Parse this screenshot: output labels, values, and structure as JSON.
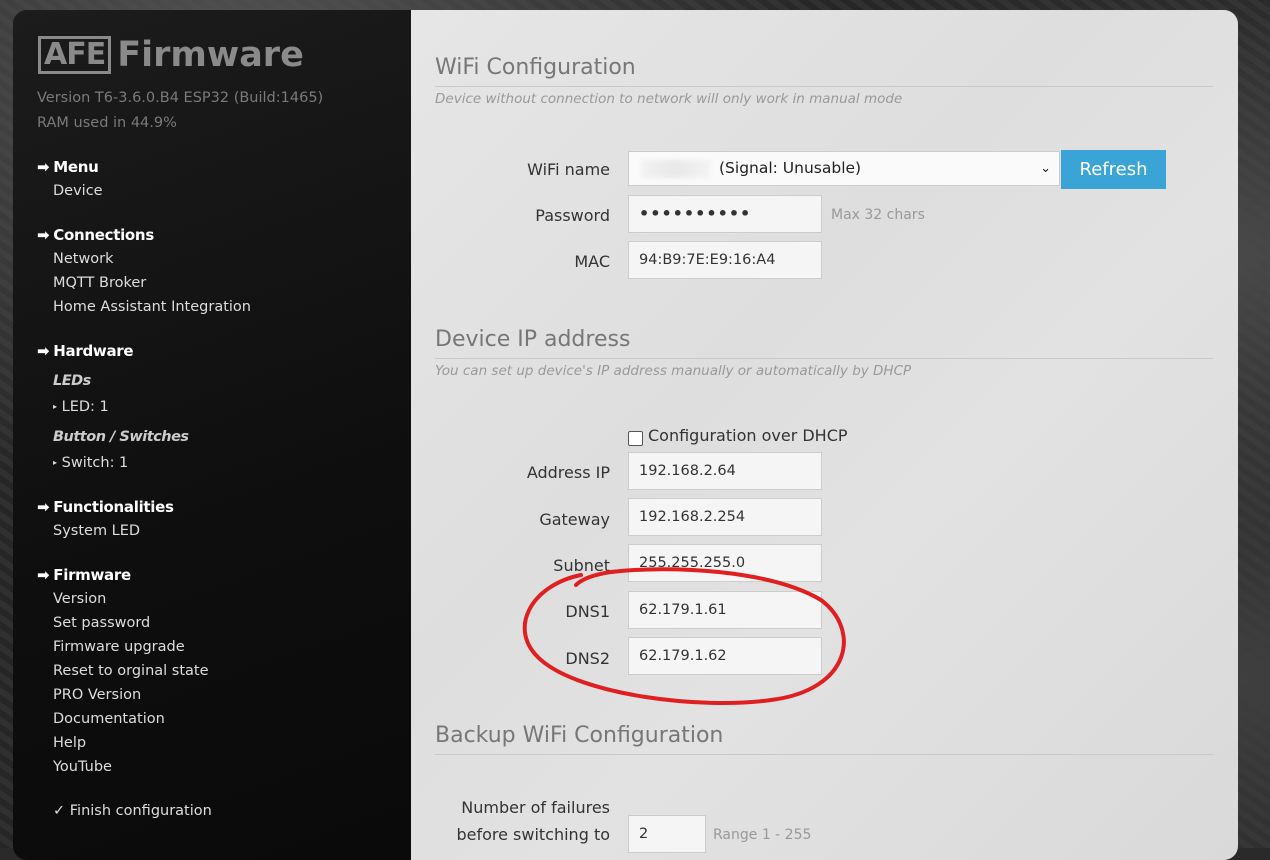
{
  "logo": {
    "box": "AFE",
    "text": "Firmware"
  },
  "version_line": "Version T6-3.6.0.B4 ESP32 (Build:1465)",
  "ram_line": "RAM used in 44.9%",
  "nav": {
    "menu": {
      "head": "Menu",
      "items": [
        "Device"
      ]
    },
    "connections": {
      "head": "Connections",
      "items": [
        "Network",
        "MQTT Broker",
        "Home Assistant Integration"
      ]
    },
    "hardware": {
      "head": "Hardware",
      "leds_label": "LEDs",
      "leds_item": "LED: 1",
      "buttons_label": "Button / Switches",
      "switch_item": "Switch: 1"
    },
    "functionalities": {
      "head": "Functionalities",
      "items": [
        "System LED"
      ]
    },
    "firmware": {
      "head": "Firmware",
      "items": [
        "Version",
        "Set password",
        "Firmware upgrade",
        "Reset to orginal state",
        "PRO Version",
        "Documentation",
        "Help",
        "YouTube"
      ]
    },
    "finish": "Finish configuration"
  },
  "wifi": {
    "title": "WiFi Configuration",
    "subtitle": "Device without connection to network will only work in manual mode",
    "name_label": "WiFi name",
    "name_value": "(Signal: Unusable)",
    "refresh_label": "Refresh",
    "password_label": "Password",
    "password_value": "••••••••••",
    "password_hint": "Max 32 chars",
    "mac_label": "MAC",
    "mac_value": "94:B9:7E:E9:16:A4"
  },
  "ip": {
    "title": "Device IP address",
    "subtitle": "You can set up device's IP address manually or automatically by DHCP",
    "dhcp_label": "Configuration over DHCP",
    "address_label": "Address IP",
    "address_value": "192.168.2.64",
    "gateway_label": "Gateway",
    "gateway_value": "192.168.2.254",
    "subnet_label": "Subnet",
    "subnet_value": "255.255.255.0",
    "dns1_label": "DNS1",
    "dns1_value": "62.179.1.61",
    "dns2_label": "DNS2",
    "dns2_value": "62.179.1.62"
  },
  "backup": {
    "title": "Backup WiFi Configuration",
    "failures_label_1": "Number of failures",
    "failures_label_2": "before switching to",
    "failures_value": "2",
    "failures_hint": "Range 1 - 255"
  },
  "colors": {
    "accent": "#3ba4d6",
    "annotation": "#e02020"
  },
  "icons": {
    "nav_arrow": "arrow-right-icon",
    "finish_check": "check-icon"
  }
}
